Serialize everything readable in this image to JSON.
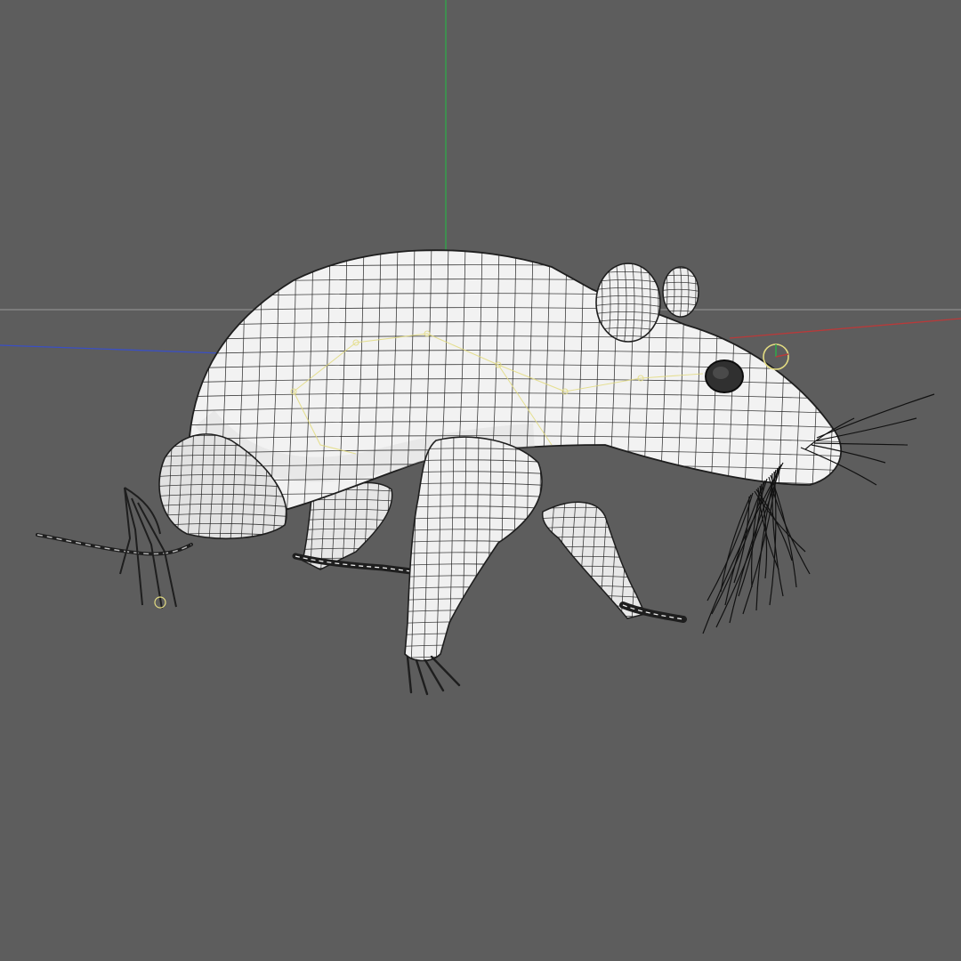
{
  "viewport": {
    "background_color": "#5d5d5d",
    "axis_colors": {
      "x": "#b83a3a",
      "y": "#2fa84a",
      "z": "#3a4fc4",
      "horizon": "#9a9a9a"
    },
    "mesh": {
      "fill_color": "#f2f2f2",
      "shade_color": "#d6d6d6",
      "wire_color": "#1e1e1e",
      "rig_color": "#e3dc82"
    },
    "object_icon": "rat-wireframe-mesh-icon",
    "pivot_icon": "pivot-gizmo-icon"
  }
}
